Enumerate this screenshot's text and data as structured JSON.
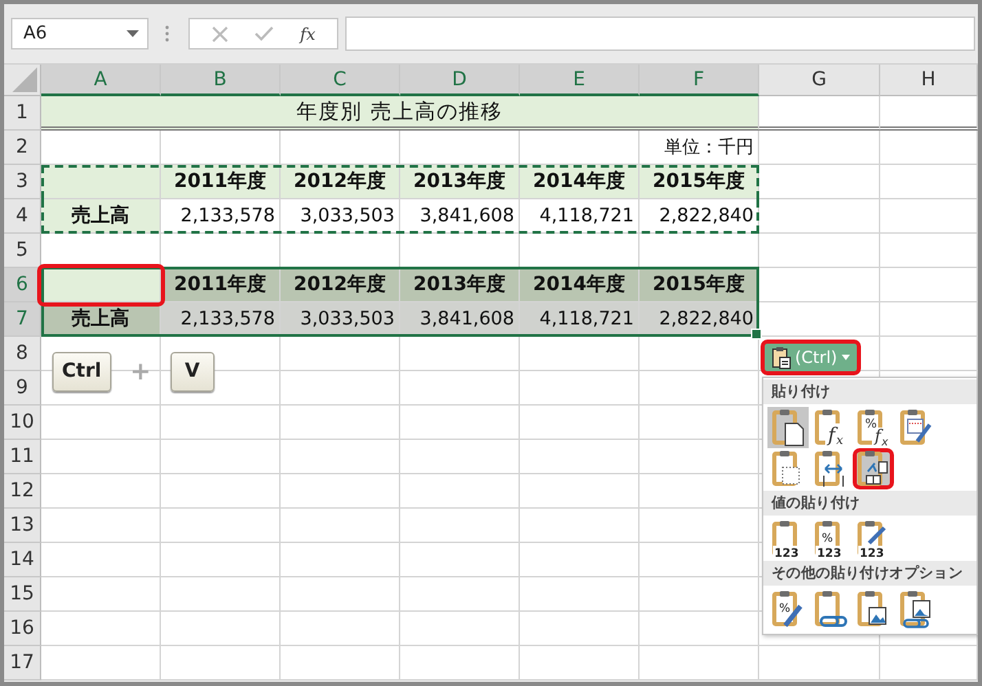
{
  "formula_bar": {
    "name_box": "A6",
    "function_label": "fx"
  },
  "columns": [
    {
      "label": "A",
      "selected": true
    },
    {
      "label": "B",
      "selected": true
    },
    {
      "label": "C",
      "selected": true
    },
    {
      "label": "D",
      "selected": true
    },
    {
      "label": "E",
      "selected": true
    },
    {
      "label": "F",
      "selected": true
    },
    {
      "label": "G",
      "selected": false
    },
    {
      "label": "H",
      "selected": false
    }
  ],
  "rows": [
    {
      "number": "1",
      "selected": false,
      "copied": false,
      "kind": "title",
      "text": "年度別 売上高の推移"
    },
    {
      "number": "2",
      "selected": false,
      "copied": false,
      "kind": "unit",
      "text": "単位：千円"
    },
    {
      "number": "3",
      "selected": false,
      "copied": true,
      "kind": "header",
      "values": [
        "2011年度",
        "2012年度",
        "2013年度",
        "2014年度",
        "2015年度"
      ]
    },
    {
      "number": "4",
      "selected": false,
      "copied": true,
      "kind": "data",
      "label": "売上高",
      "values": [
        "2,133,578",
        "3,033,503",
        "3,841,608",
        "4,118,721",
        "2,822,840"
      ]
    },
    {
      "number": "5",
      "selected": false,
      "copied": false,
      "kind": "blank"
    },
    {
      "number": "6",
      "selected": true,
      "copied": false,
      "kind": "header",
      "active_first_cell": true,
      "callout_first_cell": true,
      "values": [
        "2011年度",
        "2012年度",
        "2013年度",
        "2014年度",
        "2015年度"
      ]
    },
    {
      "number": "7",
      "selected": true,
      "copied": false,
      "kind": "data",
      "label": "売上高",
      "values": [
        "2,133,578",
        "3,033,503",
        "3,841,608",
        "4,118,721",
        "2,822,840"
      ]
    },
    {
      "number": "8",
      "selected": false,
      "copied": false,
      "kind": "blank"
    },
    {
      "number": "9",
      "selected": false,
      "copied": false,
      "kind": "blank"
    },
    {
      "number": "10",
      "selected": false,
      "copied": false,
      "kind": "blank"
    },
    {
      "number": "11",
      "selected": false,
      "copied": false,
      "kind": "blank"
    },
    {
      "number": "12",
      "selected": false,
      "copied": false,
      "kind": "blank"
    },
    {
      "number": "13",
      "selected": false,
      "copied": false,
      "kind": "blank"
    },
    {
      "number": "14",
      "selected": false,
      "copied": false,
      "kind": "blank"
    },
    {
      "number": "15",
      "selected": false,
      "copied": false,
      "kind": "blank"
    },
    {
      "number": "16",
      "selected": false,
      "copied": false,
      "kind": "blank"
    },
    {
      "number": "17",
      "selected": false,
      "copied": false,
      "kind": "blank"
    }
  ],
  "shortcut": {
    "keys": [
      "Ctrl",
      "V"
    ],
    "joiner": "+"
  },
  "paste_options": {
    "button_label": "(Ctrl)",
    "callout": true,
    "sections": [
      {
        "title": "貼り付け",
        "items": [
          {
            "kind": "paste",
            "selected": true,
            "callout": false
          },
          {
            "kind": "formulas",
            "selected": false,
            "callout": false,
            "marks": [
              "f",
              "x"
            ]
          },
          {
            "kind": "formulas-number-format",
            "selected": false,
            "callout": false,
            "marks": [
              "%",
              "f",
              "x"
            ]
          },
          {
            "kind": "keep-source-format",
            "selected": false,
            "callout": false
          },
          {
            "kind": "no-borders",
            "selected": false,
            "callout": false
          },
          {
            "kind": "column-widths",
            "selected": false,
            "callout": false
          },
          {
            "kind": "transpose",
            "selected": true,
            "callout": true
          }
        ]
      },
      {
        "title": "値の貼り付け",
        "items": [
          {
            "kind": "values",
            "selected": false,
            "callout": false,
            "marks": [
              "123"
            ]
          },
          {
            "kind": "values-number-format",
            "selected": false,
            "callout": false,
            "marks": [
              "%",
              "123"
            ]
          },
          {
            "kind": "values-source-format",
            "selected": false,
            "callout": false,
            "marks": [
              "123"
            ]
          }
        ]
      },
      {
        "title": "その他の貼り付けオプション",
        "items": [
          {
            "kind": "formatting",
            "selected": false,
            "callout": false,
            "marks": [
              "%"
            ]
          },
          {
            "kind": "paste-link",
            "selected": false,
            "callout": false
          },
          {
            "kind": "picture",
            "selected": false,
            "callout": false
          },
          {
            "kind": "linked-picture",
            "selected": false,
            "callout": false
          }
        ]
      }
    ]
  }
}
